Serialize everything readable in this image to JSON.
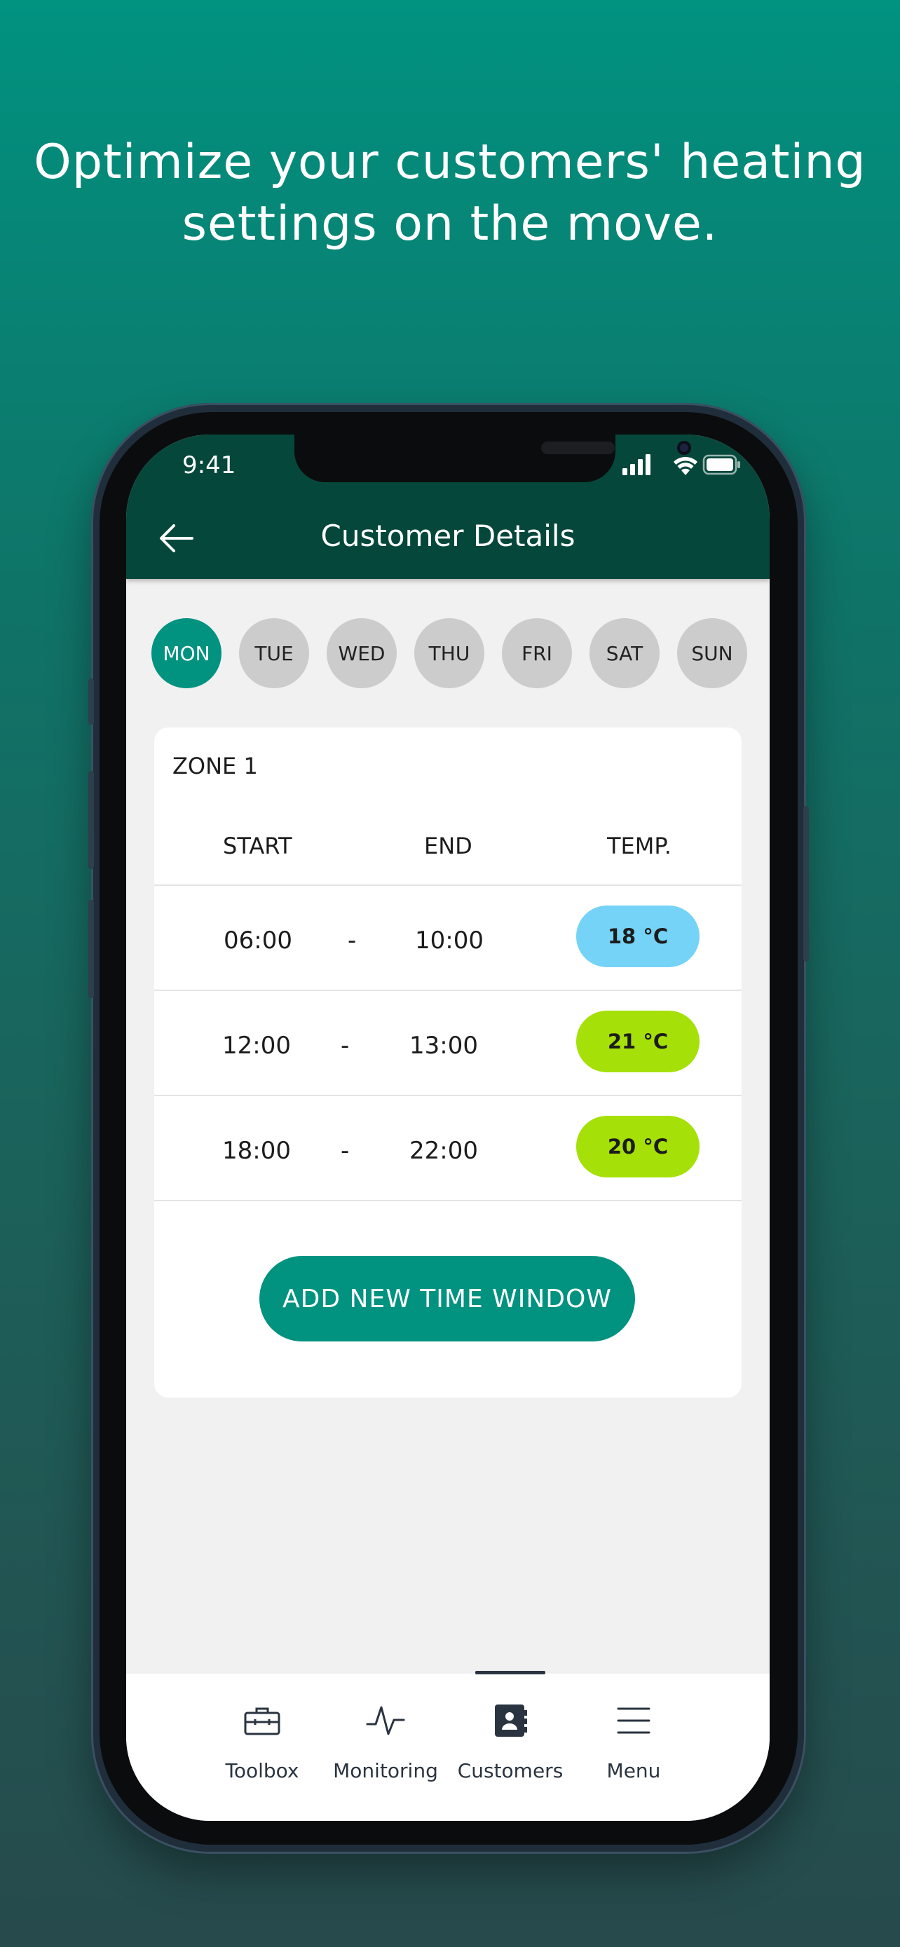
{
  "headline": {
    "line1": "Optimize your customers' heating",
    "line2": "settings on the move."
  },
  "status_bar": {
    "time": "9:41"
  },
  "app_bar": {
    "title": "Customer Details"
  },
  "days": [
    {
      "label": "MON",
      "active": true
    },
    {
      "label": "TUE",
      "active": false
    },
    {
      "label": "WED",
      "active": false
    },
    {
      "label": "THU",
      "active": false
    },
    {
      "label": "FRI",
      "active": false
    },
    {
      "label": "SAT",
      "active": false
    },
    {
      "label": "SUN",
      "active": false
    }
  ],
  "zone": {
    "title": "ZONE 1",
    "columns": {
      "start": "START",
      "end": "END",
      "temp": "TEMP."
    },
    "rows": [
      {
        "start": "06:00",
        "sep": "-",
        "end": "10:00",
        "temp": "18 °C",
        "color": "#75d3f7"
      },
      {
        "start": "12:00",
        "sep": "-",
        "end": "13:00",
        "temp": "21 °C",
        "color": "#a6e009"
      },
      {
        "start": "18:00",
        "sep": "-",
        "end": "22:00",
        "temp": "20 °C",
        "color": "#a6e009"
      }
    ],
    "add_button": "ADD NEW TIME WINDOW"
  },
  "bottom_nav": [
    {
      "label": "Toolbox",
      "icon": "toolbox-icon"
    },
    {
      "label": "Monitoring",
      "icon": "monitoring-icon"
    },
    {
      "label": "Customers",
      "icon": "customers-icon",
      "active": true
    },
    {
      "label": "Menu",
      "icon": "menu-icon"
    }
  ],
  "colors": {
    "brand": "#019280",
    "appbar": "#05483b",
    "temp_cool": "#75d3f7",
    "temp_warm": "#a6e009"
  }
}
